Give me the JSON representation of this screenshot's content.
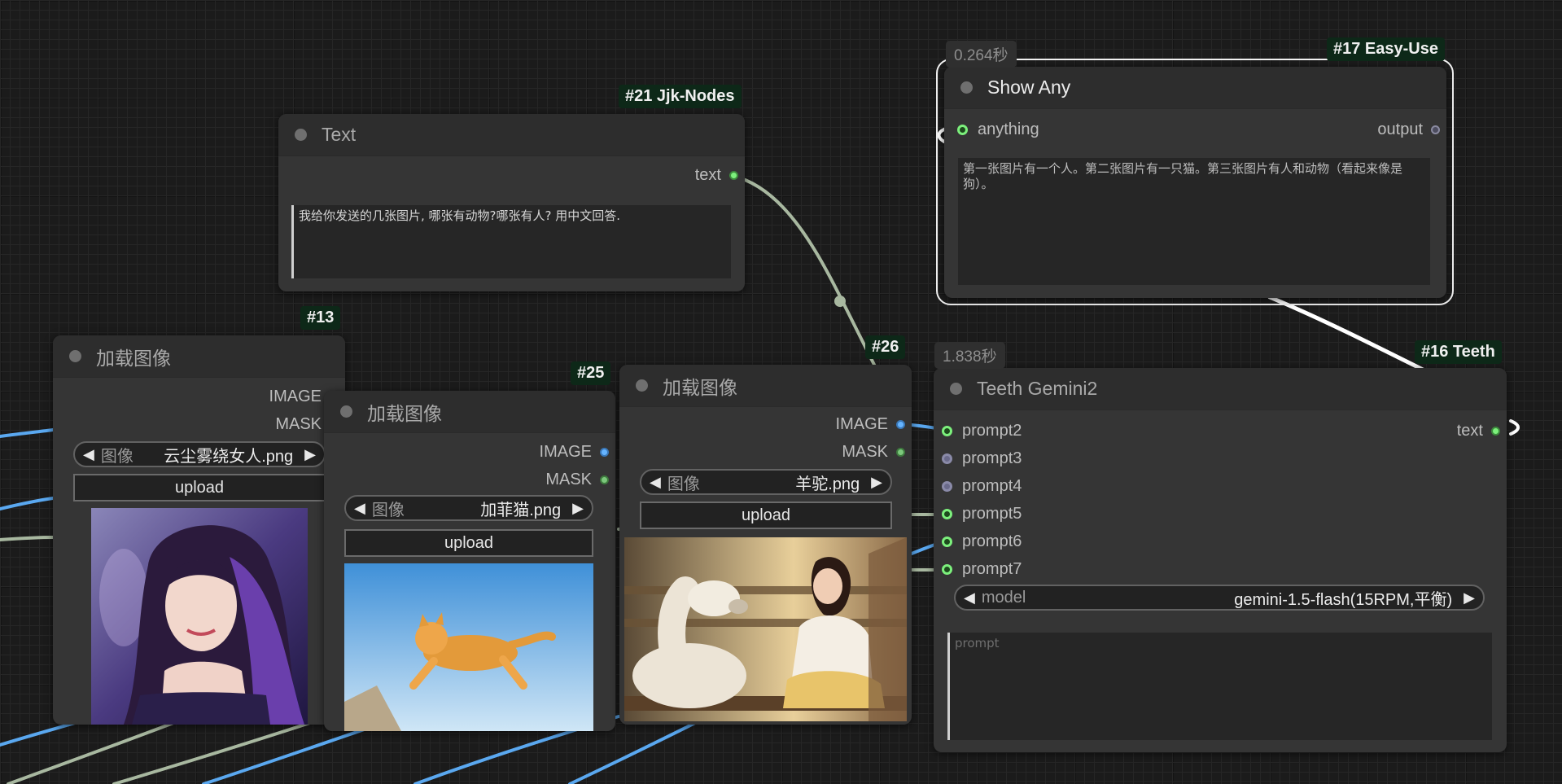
{
  "nodes": {
    "text_node": {
      "badge": "#21 Jjk-Nodes",
      "title": "Text",
      "output_label": "text",
      "textarea_value": "我给你发送的几张图片, 哪张有动物?哪张有人? 用中文回答."
    },
    "load13": {
      "badge": "#13",
      "title": "加载图像",
      "out_image": "IMAGE",
      "out_mask": "MASK",
      "combo_label": "图像",
      "combo_value": "云尘雾绕女人.png",
      "upload_label": "upload"
    },
    "load25": {
      "badge": "#25",
      "title": "加载图像",
      "out_image": "IMAGE",
      "out_mask": "MASK",
      "combo_label": "图像",
      "combo_value": "加菲猫.png",
      "upload_label": "upload"
    },
    "load26": {
      "badge": "#26",
      "title": "加载图像",
      "out_image": "IMAGE",
      "out_mask": "MASK",
      "combo_label": "图像",
      "combo_value": "羊驼.png",
      "upload_label": "upload"
    },
    "show_any": {
      "badge": "#17 Easy-Use",
      "timer": "0.264秒",
      "title": "Show Any",
      "input_label": "anything",
      "output_label": "output",
      "text_value": "第一张图片有一个人。第二张图片有一只猫。第三张图片有人和动物（看起来像是狗）。"
    },
    "teeth": {
      "badge": "#16 Teeth",
      "timer": "1.838秒",
      "title": "Teeth Gemini2",
      "inputs": [
        "prompt2",
        "prompt3",
        "prompt4",
        "prompt5",
        "prompt6",
        "prompt7"
      ],
      "output_label": "text",
      "model_label": "model",
      "model_value": "gemini-1.5-flash(15RPM,平衡)",
      "prompt_placeholder": "prompt"
    }
  },
  "arrows": {
    "left": "◀",
    "right": "▶"
  },
  "colors": {
    "canvas": "#1b1b1b",
    "node_body": "#353535",
    "node_header": "#2d2d2d",
    "badge_bg": "#0d2818",
    "link_image": "#5aa8f0",
    "link_string": "#a8b8a0",
    "link_selected": "#ffffff"
  }
}
